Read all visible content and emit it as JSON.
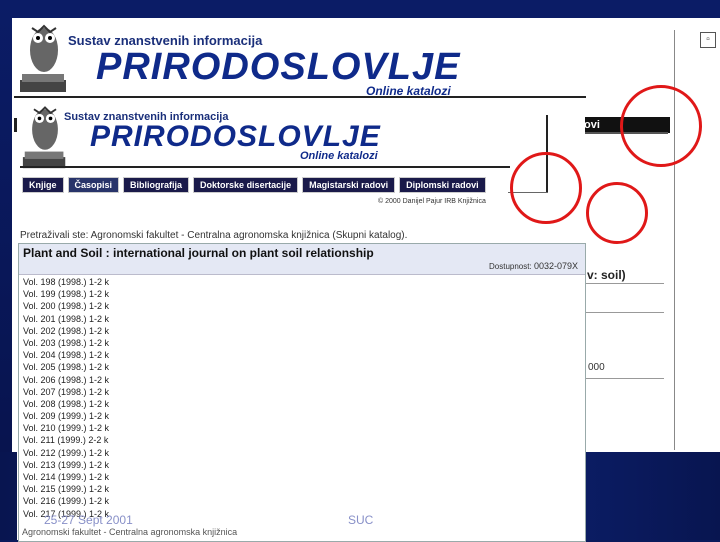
{
  "back_banner": {
    "title_top": "Sustav znanstvenih informacija",
    "title_main": "PRIRODOSLOVLJE",
    "title_sub": "Online katalozi",
    "tab_partial": "ovi"
  },
  "front_banner": {
    "title_top": "Sustav znanstvenih informacija",
    "title_main": "PRIRODOSLOVLJE",
    "title_sub": "Online katalozi"
  },
  "nav_tabs": [
    {
      "label": "Knjige"
    },
    {
      "label": "Časopisi"
    },
    {
      "label": "Bibliografija"
    },
    {
      "label": "Doktorske disertacije"
    },
    {
      "label": "Magistarski radovi"
    },
    {
      "label": "Diplomski radovi"
    }
  ],
  "copyright": "© 2000 Danijel Pajur IRB Knjižnica",
  "search_info": "Pretraživali ste: Agronomski fakultet - Centralna agronomska knjižnica (Skupni katalog).",
  "journal": {
    "title": "Plant and Soil : international journal on plant soil relationship",
    "issn_label": "Dostupnost:",
    "issn": "0032-079X"
  },
  "volumes": [
    "Vol. 198 (1998.) 1-2 k",
    "Vol. 199 (1998.) 1-2 k",
    "Vol. 200 (1998.) 1-2 k",
    "Vol. 201 (1998.) 1-2 k",
    "Vol. 202 (1998.) 1-2 k",
    "Vol. 203 (1998.) 1-2 k",
    "Vol. 204 (1998.) 1-2 k",
    "Vol. 205 (1998.) 1-2 k",
    "Vol. 206 (1998.) 1-2 k",
    "Vol. 207 (1998.) 1-2 k",
    "Vol. 208 (1998.) 1-2 k",
    "Vol. 209 (1999.) 1-2 k",
    "Vol. 210 (1999.) 1-2 k",
    "Vol. 211 (1999.) 2-2 k",
    "Vol. 212 (1999.) 1-2 k",
    "Vol. 213 (1999.) 1-2 k",
    "Vol. 214 (1999.) 1-2 k",
    "Vol. 215 (1999.) 1-2 k",
    "Vol. 216 (1999.) 1-2 k",
    "Vol. 217 (1999.) 1-2 k"
  ],
  "back_partial_text": {
    "soil": "v: soil)",
    "fragment": "000"
  },
  "footer": {
    "date": "25-27 Sept 2001",
    "org": "SUC",
    "library": "Agronomski fakultet - Centralna agronomska knjižnica"
  },
  "colors": {
    "slide_background": "#0a1a5c",
    "highlight_circle": "#e01818",
    "banner_text": "#0f2a8a"
  }
}
